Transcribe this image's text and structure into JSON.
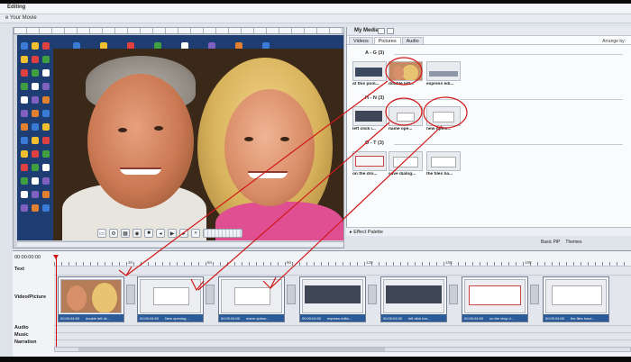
{
  "window": {
    "title": "Editing",
    "subtitle": "e Your Movie"
  },
  "media_panel": {
    "title": "My Media",
    "tabs": [
      "Videos",
      "Pictures",
      "Audio"
    ],
    "active_tab": "Pictures",
    "arrange_by": "Arrange by:",
    "groups": [
      {
        "label": "A - G (3)",
        "items": [
          "at this poin...",
          "double left...",
          "express edi..."
        ]
      },
      {
        "label": "H - N (3)",
        "items": [
          "left click i...",
          "name ope...",
          "new openi..."
        ]
      },
      {
        "label": "O - T (3)",
        "items": [
          "on the dro...",
          "save dialog...",
          "the files ha..."
        ]
      }
    ]
  },
  "effect_palette": "Effect Palette",
  "toolbar_right": [
    "Basic PiP",
    "Themes"
  ],
  "timeline": {
    "start_time": "00:00:00:00",
    "tick_labels": [
      "30",
      "60",
      "90",
      "120",
      "150",
      "180"
    ],
    "tracks": [
      "Text",
      "Video/Picture",
      "Audio",
      "Music",
      "Narration"
    ],
    "clips": [
      {
        "duration": "00:00:04:00",
        "name": "double left cli..."
      },
      {
        "duration": "00:00:04:00",
        "name": "New opening..."
      },
      {
        "duration": "00:00:04:00",
        "name": "mene option..."
      },
      {
        "duration": "00:00:04:00",
        "name": "express edito..."
      },
      {
        "duration": "00:00:04:00",
        "name": "left click lea..."
      },
      {
        "duration": "00:00:04:00",
        "name": "on the drop d..."
      },
      {
        "duration": "00:00:04:00",
        "name": "the files have..."
      }
    ]
  },
  "colors": {
    "annotation": "#d01818",
    "clip_bar": "#2c5b9a",
    "playhead": "#d01010"
  }
}
